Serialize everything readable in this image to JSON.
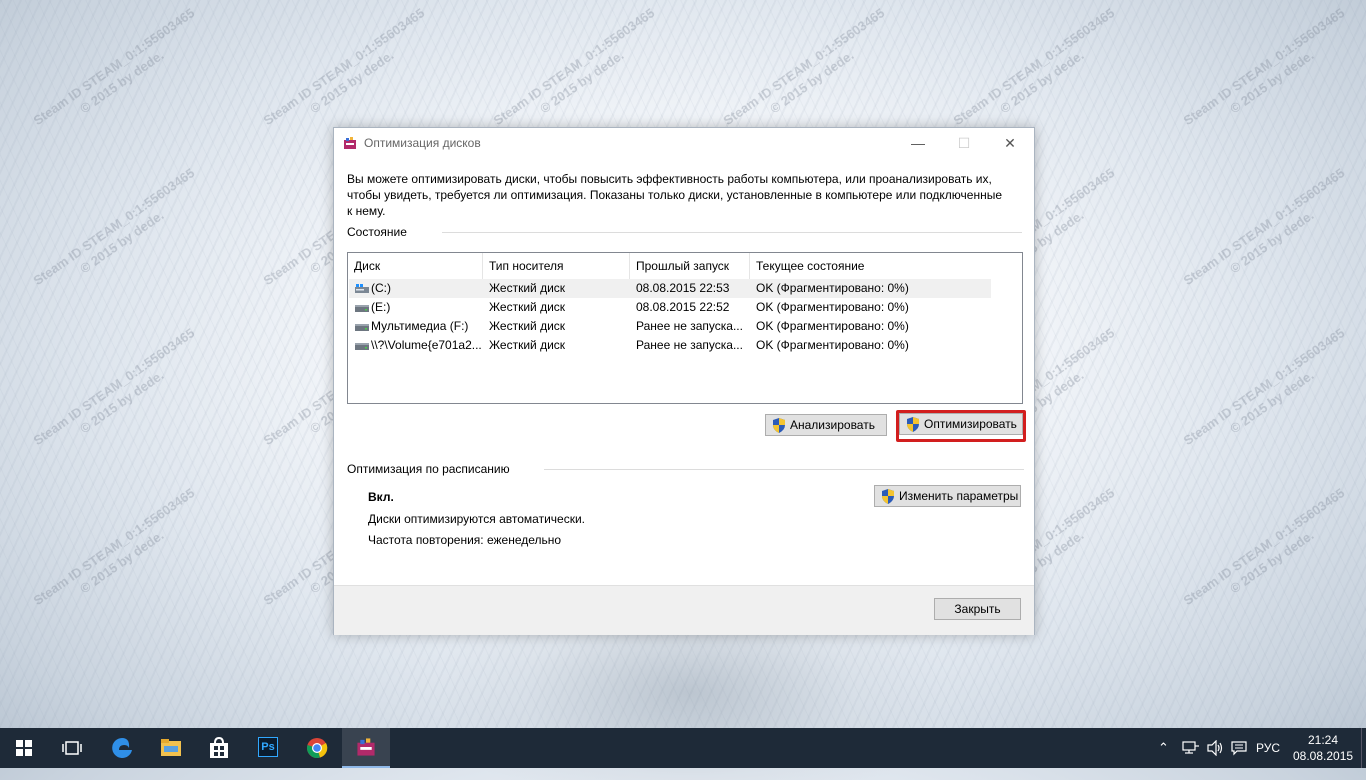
{
  "watermark": {
    "line1": "Steam ID  STEAM_0:1:55603465",
    "line2": "© 2015 by dede."
  },
  "window": {
    "title": "Оптимизация дисков",
    "controls": {
      "minimize": "—",
      "maximize": "☐",
      "close": "✕"
    },
    "description": "Вы можете оптимизировать диски, чтобы повысить эффективность работы  компьютера, или проанализировать их, чтобы увидеть, требуется ли оптимизация. Показаны только диски, установленные в компьютере или подключенные к нему.",
    "status_group": "Состояние",
    "columns": [
      "Диск",
      "Тип носителя",
      "Прошлый запуск",
      "Текущее состояние"
    ],
    "drives": [
      {
        "icon": "system-drive-icon",
        "name": "(C:)",
        "type": "Жесткий диск",
        "last_run": "08.08.2015 22:53",
        "status": "OK (Фрагментировано: 0%)"
      },
      {
        "icon": "hard-drive-icon",
        "name": "(E:)",
        "type": "Жесткий диск",
        "last_run": "08.08.2015 22:52",
        "status": "OK (Фрагментировано: 0%)"
      },
      {
        "icon": "hard-drive-icon",
        "name": "Мультимедиа (F:)",
        "type": "Жесткий диск",
        "last_run": "Ранее не запуска...",
        "status": "OK (Фрагментировано: 0%)"
      },
      {
        "icon": "hard-drive-icon",
        "name": "\\\\?\\Volume{e701a2...",
        "type": "Жесткий диск",
        "last_run": "Ранее не запуска...",
        "status": "OK (Фрагментировано: 0%)"
      }
    ],
    "analyze_button": "Анализировать",
    "optimize_button": "Оптимизировать",
    "schedule_group": "Оптимизация по расписанию",
    "schedule_state": "Вкл.",
    "schedule_info": "Диски оптимизируются автоматически.",
    "schedule_frequency": "Частота повторения: еженедельно",
    "change_button": "Изменить параметры",
    "close_button": "Закрыть"
  },
  "taskbar": {
    "pinned": [
      "windows-start-icon",
      "task-view-icon",
      "edge-icon",
      "file-explorer-icon",
      "store-icon",
      "photoshop-icon",
      "chrome-icon",
      "defrag-app-icon"
    ],
    "photoshop_label": "Ps",
    "tray": {
      "chevron": "⌃",
      "lang": "РУС"
    },
    "clock": {
      "time": "21:24",
      "date": "08.08.2015"
    }
  },
  "colors": {
    "accent_highlight": "#d21e1e",
    "taskbar": "#1e2a38"
  }
}
